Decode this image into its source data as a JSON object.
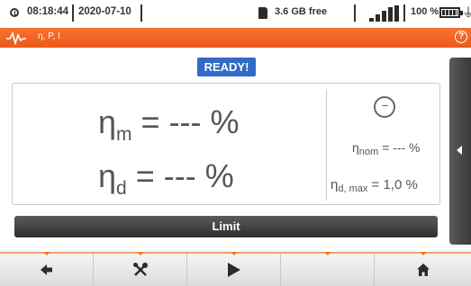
{
  "status": {
    "time": "08:18:44",
    "date": "2020-07-10",
    "storage": "3.6 GB free",
    "battery": "100 %",
    "icons": [
      "clock-icon",
      "sd-card-icon",
      "signal-icon",
      "battery-icon",
      "plug-icon"
    ]
  },
  "titlebar": {
    "mode_label": "η, P, I",
    "icons": [
      "waveform-icon",
      "help-icon"
    ],
    "help_glyph": "?"
  },
  "badge": {
    "ready": "READY!"
  },
  "measurements": {
    "eta_symbol": "η",
    "eta_m_sub": "m",
    "eta_d_sub": "d",
    "eta_m_value": "= --- %",
    "eta_d_value": "= --- %",
    "eta_nom_sub": "nom",
    "eta_nom_value": "= --- %",
    "eta_dmax_sub": "d, max",
    "eta_dmax_value": "= 1,0 %"
  },
  "limit_button": "Limit",
  "toolbar": {
    "buttons": [
      "back-arrow-icon",
      "tools-icon",
      "play-icon",
      "empty",
      "home-icon"
    ]
  },
  "colors": {
    "accent": "#ec5a1c",
    "ready_badge": "#2f6bc7",
    "dark_button": "#3a3a3a"
  }
}
